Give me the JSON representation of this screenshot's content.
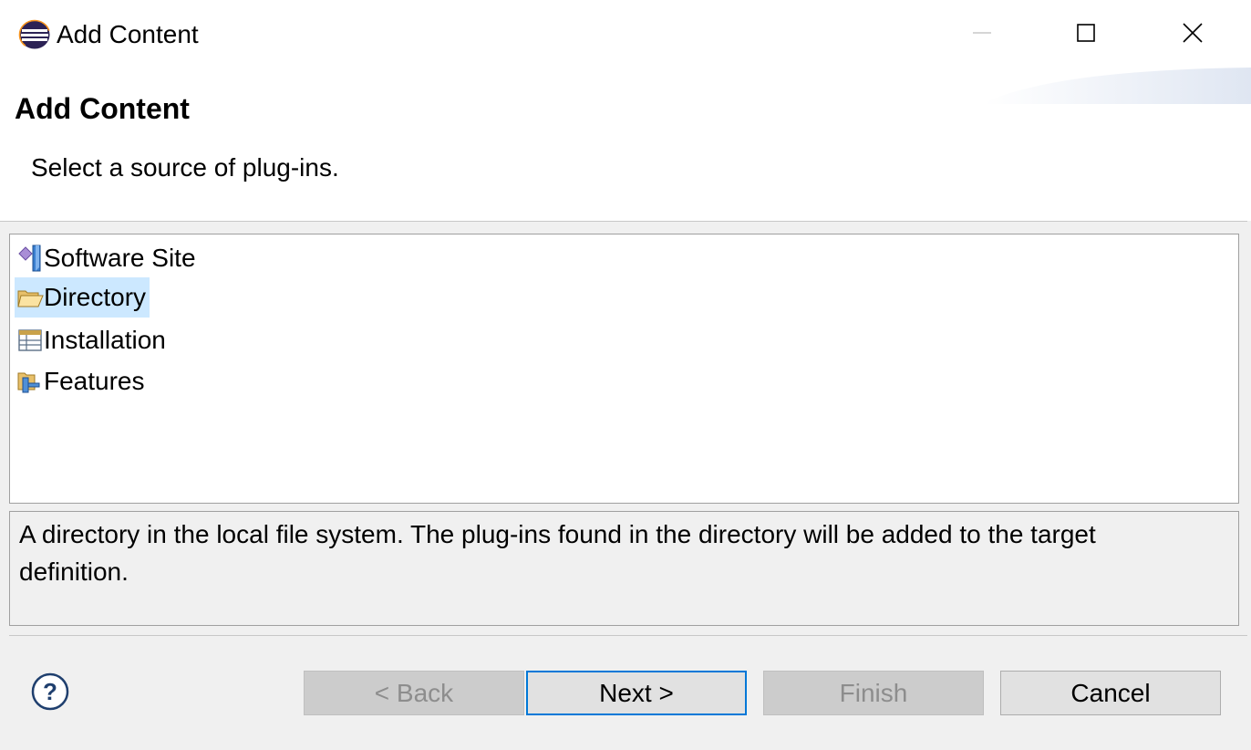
{
  "window": {
    "title": "Add Content",
    "app_icon": "eclipse-icon",
    "controls": [
      "minimize-icon",
      "maximize-icon",
      "close-icon"
    ]
  },
  "banner": {
    "title": "Add Content",
    "message": "Select a source of plug-ins."
  },
  "sources": {
    "items": [
      {
        "label": "Software Site",
        "icon": "software-site-icon",
        "selected": false
      },
      {
        "label": "Directory",
        "icon": "folder-icon",
        "selected": true
      },
      {
        "label": "Installation",
        "icon": "installation-icon",
        "selected": false
      },
      {
        "label": "Features",
        "icon": "features-icon",
        "selected": false
      }
    ]
  },
  "description": {
    "text": "A directory in the local file system. The plug-ins found in the directory will be added to the target definition."
  },
  "buttons": {
    "help_icon": "help-icon",
    "back_label": "< Back",
    "next_label": "Next >",
    "finish_label": "Finish",
    "cancel_label": "Cancel"
  },
  "colors": {
    "selection": "#cce8ff",
    "default_button_border": "#0078d7",
    "disabled_text": "#8d8d8d"
  }
}
